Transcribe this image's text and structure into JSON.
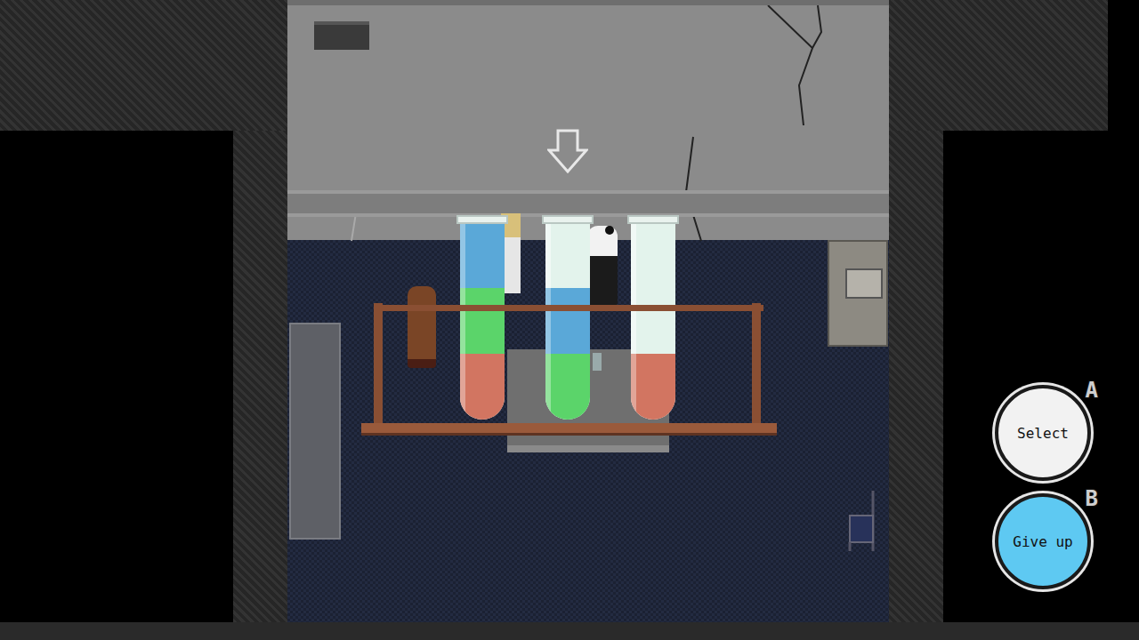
{
  "tubes": [
    {
      "selected": false,
      "layers": [
        {
          "color": "#d27561"
        },
        {
          "color": "#5bd46a"
        },
        {
          "color": "#5aa8d8"
        }
      ]
    },
    {
      "selected": true,
      "layers": [
        {
          "color": "#5bd46a"
        },
        {
          "color": "#5aa8d8"
        }
      ]
    },
    {
      "selected": false,
      "layers": [
        {
          "color": "#d27561"
        }
      ]
    }
  ],
  "buttons": [
    {
      "label": "Select",
      "key": "A",
      "color": "#f2f2f2"
    },
    {
      "label": "Give up",
      "key": "B",
      "color": "#5ec9f2"
    }
  ]
}
